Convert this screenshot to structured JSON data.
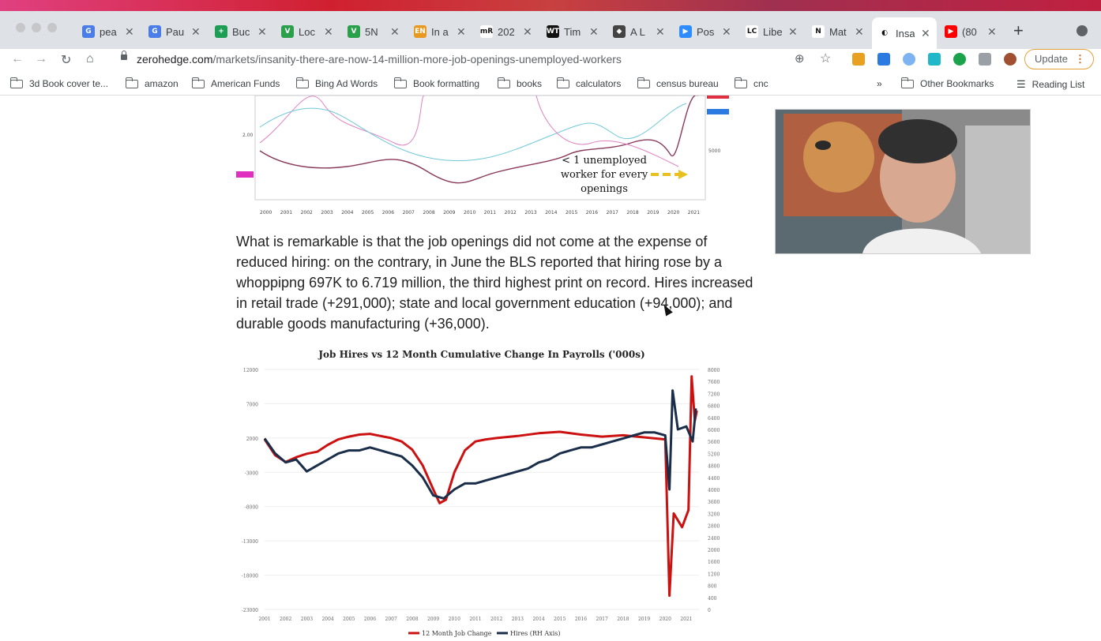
{
  "tabs": [
    {
      "title": "pea",
      "fav": "G",
      "color": "#4a7de8"
    },
    {
      "title": "Pau",
      "fav": "G",
      "color": "#4a7de8"
    },
    {
      "title": "Buc",
      "fav": "+",
      "color": "#1e9e55"
    },
    {
      "title": "Loc",
      "fav": "V",
      "color": "#2aa04a"
    },
    {
      "title": "5N",
      "fav": "V",
      "color": "#2aa04a"
    },
    {
      "title": "In a",
      "fav": "EN",
      "color": "#e89a20"
    },
    {
      "title": "202",
      "fav": "mR",
      "color": "#ffffff"
    },
    {
      "title": "Tim",
      "fav": "WT",
      "color": "#111111"
    },
    {
      "title": "A L",
      "fav": "◆",
      "color": "#444444"
    },
    {
      "title": "Pos",
      "fav": "▶",
      "color": "#2d8cff"
    },
    {
      "title": "Libe",
      "fav": "LC",
      "color": "#ffffff"
    },
    {
      "title": "Mat",
      "fav": "N",
      "color": "#ffffff"
    },
    {
      "title": "Insa",
      "fav": "◐",
      "color": "#ffffff"
    },
    {
      "title": "(80",
      "fav": "▶",
      "color": "#ff0000"
    }
  ],
  "url": {
    "host": "zerohedge.com",
    "path": "/markets/insanity-there-are-now-14-million-more-job-openings-unemployed-workers"
  },
  "update_label": "Update",
  "bookmarks": [
    "3d Book cover te...",
    "amazon",
    "American Funds",
    "Bing Ad Words",
    "Book formatting",
    "books",
    "calculators",
    "census bureau",
    "cnc"
  ],
  "bookmarks_right": {
    "other": "Other Bookmarks",
    "reading": "Reading List"
  },
  "article": {
    "paragraph": "What is remarkable is that the job openings did not come at the expense of reduced hiring: on the contrary, in June the BLS reported that hiring rose by a whoppipng 697K to 6.719 million, the third highest print on record. Hires increased in retail trade (+291,000); state and local government education (+94,000); and durable goods manufacturing (+36,000)."
  },
  "chart_top": {
    "annotation": [
      "< 1 unemployed",
      "worker for every",
      "openings"
    ],
    "ytick": "2.00",
    "ytick_right": "5000",
    "years": [
      "2000",
      "2001",
      "2002",
      "2003",
      "2004",
      "2005",
      "2006",
      "2007",
      "2008",
      "2009",
      "2010",
      "2011",
      "2012",
      "2013",
      "2014",
      "2015",
      "2016",
      "2017",
      "2018",
      "2019",
      "2020",
      "2021"
    ]
  },
  "chart_data": {
    "type": "line",
    "title": "Job Hires vs 12 Month Cumulative Change In Payrolls ('000s)",
    "x": [
      "2001",
      "2002",
      "2003",
      "2004",
      "2005",
      "2006",
      "2007",
      "2008",
      "2009",
      "2010",
      "2011",
      "2012",
      "2013",
      "2014",
      "2015",
      "2016",
      "2017",
      "2018",
      "2019",
      "2020",
      "2021"
    ],
    "yleft_ticks": [
      "12000",
      "7000",
      "2000",
      "-3000",
      "-8000",
      "-13000",
      "-18000",
      "-23000"
    ],
    "yright_ticks": [
      "8000",
      "7600",
      "7200",
      "6800",
      "6400",
      "6000",
      "5600",
      "5200",
      "4800",
      "4400",
      "4000",
      "3600",
      "3200",
      "2800",
      "2400",
      "2000",
      "1600",
      "1200",
      "800",
      "400",
      "0"
    ],
    "ylim_left": [
      -23000,
      12000
    ],
    "ylim_right": [
      0,
      8000
    ],
    "series": [
      {
        "name": "12 Month Job Change",
        "color": "#cc1111",
        "axis": "left",
        "values": [
          [
            2001.0,
            1800
          ],
          [
            2001.5,
            -500
          ],
          [
            2002.0,
            -1500
          ],
          [
            2002.5,
            -800
          ],
          [
            2003.0,
            -300
          ],
          [
            2003.5,
            0
          ],
          [
            2004.0,
            1000
          ],
          [
            2004.5,
            1800
          ],
          [
            2005.0,
            2200
          ],
          [
            2005.5,
            2500
          ],
          [
            2006.0,
            2600
          ],
          [
            2006.5,
            2300
          ],
          [
            2007.0,
            2000
          ],
          [
            2007.5,
            1500
          ],
          [
            2008.0,
            300
          ],
          [
            2008.5,
            -2000
          ],
          [
            2009.0,
            -5500
          ],
          [
            2009.3,
            -7500
          ],
          [
            2009.6,
            -7000
          ],
          [
            2010.0,
            -3000
          ],
          [
            2010.5,
            200
          ],
          [
            2011.0,
            1500
          ],
          [
            2011.5,
            1800
          ],
          [
            2012.0,
            2000
          ],
          [
            2013.0,
            2300
          ],
          [
            2014.0,
            2700
          ],
          [
            2015.0,
            2900
          ],
          [
            2016.0,
            2500
          ],
          [
            2017.0,
            2200
          ],
          [
            2018.0,
            2400
          ],
          [
            2019.0,
            2100
          ],
          [
            2020.0,
            1800
          ],
          [
            2020.2,
            -21000
          ],
          [
            2020.4,
            -9000
          ],
          [
            2020.8,
            -11000
          ],
          [
            2021.1,
            -8500
          ],
          [
            2021.25,
            11000
          ],
          [
            2021.4,
            4500
          ],
          [
            2021.5,
            6000
          ]
        ]
      },
      {
        "name": "Hires (RH Axis)",
        "color": "#1a2e4a",
        "axis": "right",
        "values": [
          [
            2001.0,
            5700
          ],
          [
            2001.5,
            5200
          ],
          [
            2002.0,
            4900
          ],
          [
            2002.5,
            5000
          ],
          [
            2003.0,
            4600
          ],
          [
            2003.5,
            4800
          ],
          [
            2004.0,
            5000
          ],
          [
            2004.5,
            5200
          ],
          [
            2005.0,
            5300
          ],
          [
            2005.5,
            5300
          ],
          [
            2006.0,
            5400
          ],
          [
            2006.5,
            5300
          ],
          [
            2007.0,
            5200
          ],
          [
            2007.5,
            5100
          ],
          [
            2008.0,
            4800
          ],
          [
            2008.5,
            4400
          ],
          [
            2009.0,
            3800
          ],
          [
            2009.5,
            3700
          ],
          [
            2010.0,
            4000
          ],
          [
            2010.5,
            4200
          ],
          [
            2011.0,
            4200
          ],
          [
            2011.5,
            4300
          ],
          [
            2012.0,
            4400
          ],
          [
            2012.5,
            4500
          ],
          [
            2013.0,
            4600
          ],
          [
            2013.5,
            4700
          ],
          [
            2014.0,
            4900
          ],
          [
            2014.5,
            5000
          ],
          [
            2015.0,
            5200
          ],
          [
            2015.5,
            5300
          ],
          [
            2016.0,
            5400
          ],
          [
            2016.5,
            5400
          ],
          [
            2017.0,
            5500
          ],
          [
            2017.5,
            5600
          ],
          [
            2018.0,
            5700
          ],
          [
            2018.5,
            5800
          ],
          [
            2019.0,
            5900
          ],
          [
            2019.5,
            5900
          ],
          [
            2020.0,
            5800
          ],
          [
            2020.2,
            4000
          ],
          [
            2020.35,
            7300
          ],
          [
            2020.6,
            6000
          ],
          [
            2021.0,
            6100
          ],
          [
            2021.3,
            5600
          ],
          [
            2021.45,
            6700
          ]
        ]
      }
    ],
    "legend": "bottom"
  }
}
